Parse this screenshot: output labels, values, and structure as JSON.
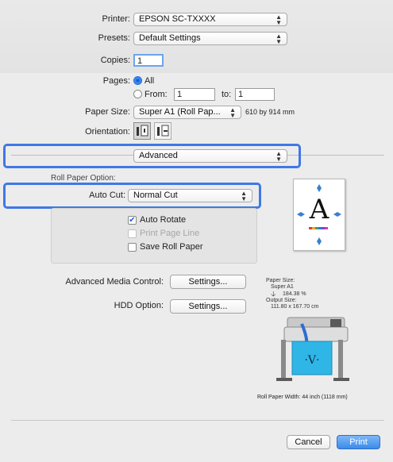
{
  "printer": {
    "label": "Printer:",
    "value": "EPSON SC-TXXXX"
  },
  "presets": {
    "label": "Presets:",
    "value": "Default Settings"
  },
  "copies": {
    "label": "Copies:",
    "value": "1"
  },
  "pages": {
    "label": "Pages:",
    "all_label": "All",
    "from_label": "From:",
    "from_value": "1",
    "to_label": "to:",
    "to_value": "1"
  },
  "paper_size": {
    "label": "Paper Size:",
    "value": "Super A1 (Roll Pap...",
    "dimensions": "610 by 914 mm"
  },
  "orientation": {
    "label": "Orientation:"
  },
  "section_popup": {
    "value": "Advanced"
  },
  "roll_paper_option": {
    "title": "Roll Paper Option:"
  },
  "auto_cut": {
    "label": "Auto Cut:",
    "value": "Normal Cut"
  },
  "options": {
    "auto_rotate": "Auto Rotate",
    "print_page_line": "Print Page Line",
    "save_roll_paper": "Save Roll Paper"
  },
  "advanced_media_control": {
    "label": "Advanced Media Control:",
    "button": "Settings..."
  },
  "hdd_option": {
    "label": "HDD Option:",
    "button": "Settings..."
  },
  "preview": {
    "letter": "A"
  },
  "paper_info": {
    "paper_size_label": "Paper Size:",
    "paper_size_value": "Super A1",
    "scale_value": "184.38 %",
    "output_size_label": "Output Size:",
    "output_size_value": "111.80 x 167.70 cm"
  },
  "roll_paper_width": "Roll Paper Width: 44 inch (1118 mm)",
  "buttons": {
    "cancel": "Cancel",
    "print": "Print"
  },
  "colors": {
    "highlight": "#3f78e6",
    "primary_button": "#3c8be9",
    "printer_paper": "#2fb6e6"
  }
}
